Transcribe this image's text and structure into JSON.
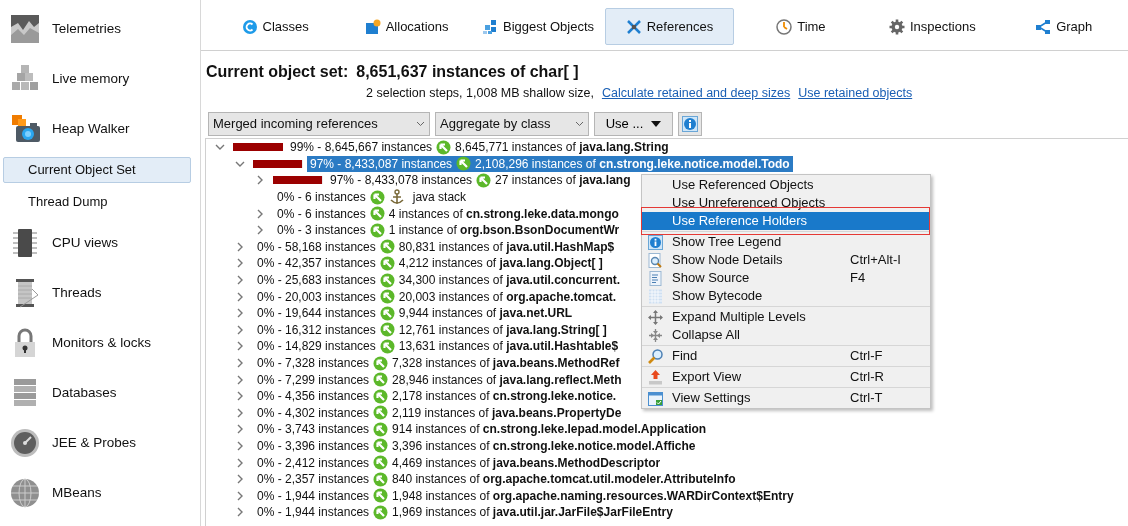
{
  "sidebar": {
    "items": [
      {
        "kind": "section",
        "label": "Telemetries"
      },
      {
        "kind": "section",
        "label": "Live memory"
      },
      {
        "kind": "section",
        "label": "Heap Walker"
      },
      {
        "kind": "sub",
        "label": "Current Object Set",
        "selected": true
      },
      {
        "kind": "sub",
        "label": "Thread Dump",
        "selected": false
      },
      {
        "kind": "section",
        "label": "CPU views"
      },
      {
        "kind": "section",
        "label": "Threads"
      },
      {
        "kind": "section",
        "label": "Monitors & locks"
      },
      {
        "kind": "section",
        "label": "Databases"
      },
      {
        "kind": "section",
        "label": "JEE & Probes"
      },
      {
        "kind": "section",
        "label": "MBeans"
      }
    ]
  },
  "tabs": [
    {
      "label": "Classes",
      "selected": false
    },
    {
      "label": "Allocations",
      "selected": false
    },
    {
      "label": "Biggest Objects",
      "selected": false
    },
    {
      "label": "References",
      "selected": true
    },
    {
      "label": "Time",
      "selected": false
    },
    {
      "label": "Inspections",
      "selected": false
    },
    {
      "label": "Graph",
      "selected": false
    }
  ],
  "header": {
    "title": "Current object set:",
    "subject": "8,651,637 instances of char[ ]",
    "summary": "2 selection steps, 1,008 MB shallow size,",
    "links": [
      "Calculate retained and deep sizes",
      "Use retained objects"
    ]
  },
  "toolbar": {
    "dropdowns": [
      "Merged incoming references",
      "Aggregate by class"
    ],
    "use_button": "Use ..."
  },
  "tree": [
    {
      "summary": "99% - 8,645,667 instances",
      "text": "8,645,771 instances of **java.lang.String**",
      "kind": "class",
      "level": 0.99,
      "expanded": true,
      "selected": false,
      "children": [
        {
          "summary": "97% - 8,433,087 instances",
          "text": "2,108,296 instances of **cn.strong.leke.notice.model.Todo**",
          "kind": "class",
          "level": 0.97,
          "expanded": true,
          "selected": true,
          "children": [
            {
              "summary": "97% - 8,433,078 instances",
              "text": "27 instances of **java.lang**",
              "kind": "class",
              "level": 0.97,
              "expanded": false,
              "selected": false
            },
            {
              "summary": "0% - 6 instances",
              "text": "java stack",
              "kind": "gc_root",
              "selected": false
            },
            {
              "summary": "0% - 6 instances",
              "text": "4 instances of **cn.strong.leke.data.mongo**",
              "kind": "class",
              "expanded": false,
              "selected": false
            },
            {
              "summary": "0% - 3 instances",
              "text": "1 instance of **org.bson.BsonDocumentWr**",
              "kind": "class",
              "expanded": false,
              "selected": false
            }
          ]
        },
        {
          "summary": "0% - 58,168 instances",
          "text": "80,831 instances of **java.util.HashMap$**",
          "kind": "class",
          "expanded": false,
          "selected": false
        },
        {
          "summary": "0% - 42,357 instances",
          "text": "4,212 instances of **java.lang.Object[ ]**",
          "kind": "class",
          "expanded": false,
          "selected": false
        },
        {
          "summary": "0% - 25,683 instances",
          "text": "34,300 instances of **java.util.concurrent.**",
          "kind": "class",
          "expanded": false,
          "selected": false
        },
        {
          "summary": "0% - 20,003 instances",
          "text": "20,003 instances of **org.apache.tomcat.**",
          "kind": "class",
          "expanded": false,
          "selected": false
        },
        {
          "summary": "0% - 19,644 instances",
          "text": "9,944 instances of **java.net.URL**",
          "kind": "class",
          "expanded": false,
          "selected": false
        },
        {
          "summary": "0% - 16,312 instances",
          "text": "12,761 instances of **java.lang.String[ ]**",
          "kind": "class",
          "expanded": false,
          "selected": false
        },
        {
          "summary": "0% - 14,829 instances",
          "text": "13,631 instances of **java.util.Hashtable$**",
          "kind": "class",
          "expanded": false,
          "selected": false
        },
        {
          "summary": "0% - 7,328 instances",
          "text": "7,328 instances of **java.beans.MethodRef**",
          "kind": "class",
          "expanded": false,
          "selected": false
        },
        {
          "summary": "0% - 7,299 instances",
          "text": "28,946 instances of **java.lang.reflect.Meth**",
          "kind": "class",
          "expanded": false,
          "selected": false
        },
        {
          "summary": "0% - 4,356 instances",
          "text": "2,178 instances of **cn.strong.leke.notice.**",
          "kind": "class",
          "expanded": false,
          "selected": false
        },
        {
          "summary": "0% - 4,302 instances",
          "text": "2,119 instances of **java.beans.PropertyDe**",
          "kind": "class",
          "expanded": false,
          "selected": false
        },
        {
          "summary": "0% - 3,743 instances",
          "text": "914 instances of **cn.strong.leke.lepad.model.Application**",
          "kind": "class",
          "expanded": false,
          "selected": false
        },
        {
          "summary": "0% - 3,396 instances",
          "text": "3,396 instances of **cn.strong.leke.notice.model.Affiche**",
          "kind": "class",
          "expanded": false,
          "selected": false
        },
        {
          "summary": "0% - 2,412 instances",
          "text": "4,469 instances of **java.beans.MethodDescriptor**",
          "kind": "class",
          "expanded": false,
          "selected": false
        },
        {
          "summary": "0% - 2,357 instances",
          "text": "840 instances of **org.apache.tomcat.util.modeler.AttributeInfo**",
          "kind": "class",
          "expanded": false,
          "selected": false
        },
        {
          "summary": "0% - 1,944 instances",
          "text": "1,948 instances of **org.apache.naming.resources.WARDirContext$Entry**",
          "kind": "class",
          "expanded": false,
          "selected": false
        },
        {
          "summary": "0% - 1,944 instances",
          "text": "1,969 instances of **java.util.jar.JarFile$JarFileEntry**",
          "kind": "class",
          "expanded": false,
          "selected": false
        }
      ]
    }
  ],
  "menu": {
    "groups": [
      {
        "items": [
          {
            "label": "Use Referenced Objects",
            "selected": false,
            "annotated": false
          },
          {
            "label": "Use Unreferenced Objects",
            "selected": false,
            "annotated": false
          },
          {
            "label": "Use Reference Holders",
            "selected": true,
            "annotated": true
          }
        ]
      },
      {
        "items": [
          {
            "label": "Show Tree Legend",
            "selected": false
          },
          {
            "label": "Show Node Details",
            "shortcut": "Ctrl+Alt-I",
            "selected": false
          },
          {
            "label": "Show Source",
            "shortcut": "F4",
            "selected": false
          },
          {
            "label": "Show Bytecode",
            "selected": false
          }
        ]
      },
      {
        "items": [
          {
            "label": "Expand Multiple Levels",
            "selected": false
          },
          {
            "label": "Collapse All",
            "selected": false
          }
        ]
      },
      {
        "items": [
          {
            "label": "Find",
            "shortcut": "Ctrl-F",
            "selected": false
          }
        ]
      },
      {
        "items": [
          {
            "label": "Export View",
            "shortcut": "Ctrl-R",
            "selected": false
          }
        ]
      },
      {
        "items": [
          {
            "label": "View Settings",
            "shortcut": "Ctrl-T",
            "selected": false
          }
        ]
      }
    ]
  }
}
